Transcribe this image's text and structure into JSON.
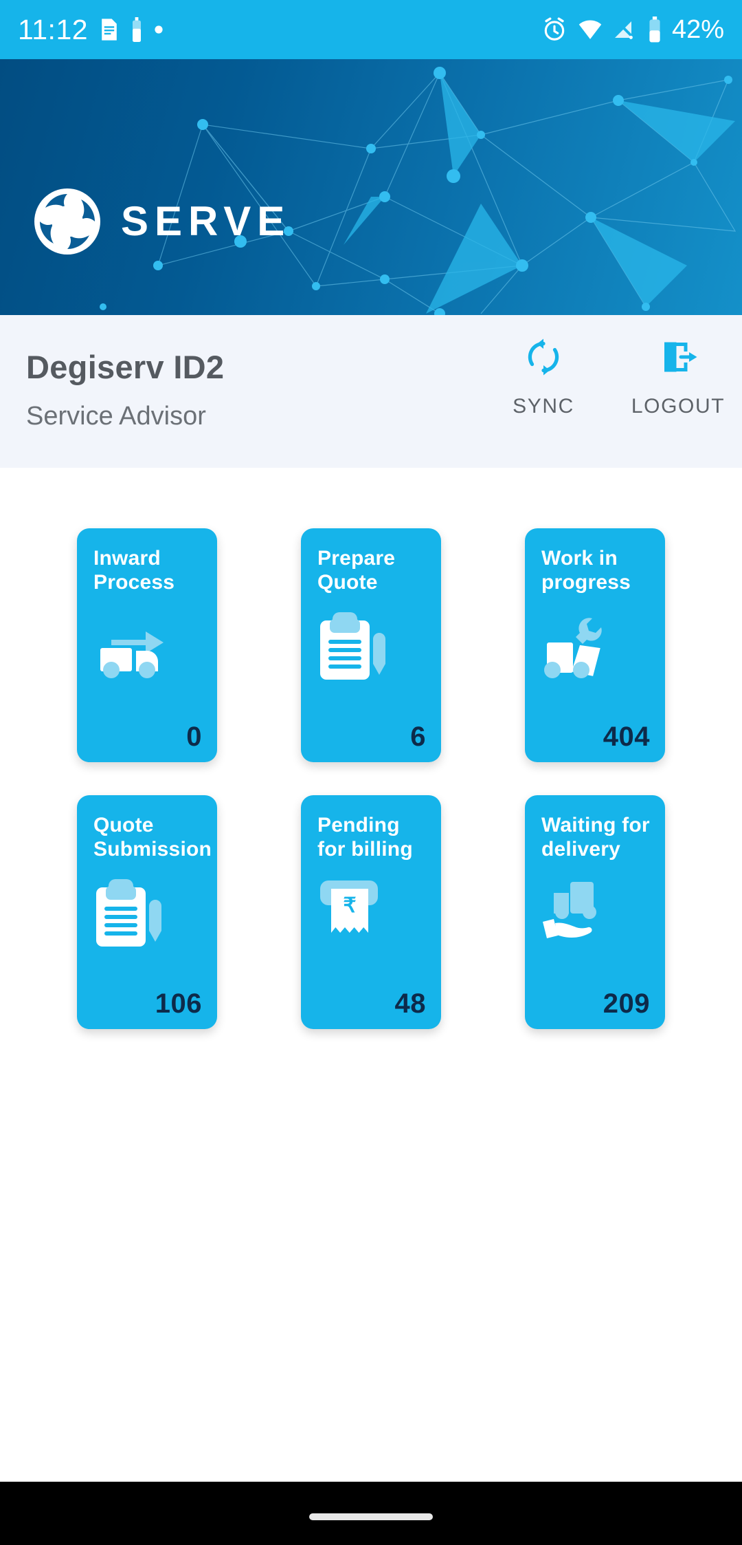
{
  "status_bar": {
    "time": "11:12",
    "battery_percent": "42%",
    "left_icons": [
      "document-icon",
      "battery-small-icon",
      "dot-icon"
    ],
    "right_icons": [
      "alarm-icon",
      "wifi-icon",
      "signal-off-icon",
      "battery-icon"
    ]
  },
  "banner": {
    "brand_name": "SERVE",
    "logo_icon": "ashok-leyland-logo-icon",
    "gradient_from": "#024d82",
    "gradient_to": "#1490c9"
  },
  "user_bar": {
    "name": "Degiserv ID2",
    "role": "Service Advisor",
    "actions": [
      {
        "label": "SYNC",
        "icon": "sync-refresh-icon"
      },
      {
        "label": "LOGOUT",
        "icon": "logout-exit-icon"
      }
    ]
  },
  "cards": [
    {
      "title_line1": "Inward",
      "title_line2": "Process",
      "count": "0",
      "icon": "truck-arrow-icon"
    },
    {
      "title_line1": "Prepare",
      "title_line2": "Quote",
      "count": "6",
      "icon": "clipboard-pen-icon"
    },
    {
      "title_line1": "Work in",
      "title_line2": "progress",
      "count": "404",
      "icon": "truck-wrench-icon"
    },
    {
      "title_line1": "Quote",
      "title_line2": "Submission",
      "count": "106",
      "icon": "clipboard-pen-icon"
    },
    {
      "title_line1": "Pending",
      "title_line2": "for billing",
      "count": "48",
      "icon": "receipt-rupee-icon"
    },
    {
      "title_line1": "Waiting for",
      "title_line2": "delivery",
      "count": "209",
      "icon": "hand-truck-delivery-icon"
    }
  ],
  "colors": {
    "accent": "#16b4ea",
    "card_bg": "#16b4ea",
    "count_text": "#0d2a4a",
    "userbar_bg": "#f2f5fb"
  },
  "nav_bar": {
    "gesture_pill": "home-gesture-pill"
  }
}
